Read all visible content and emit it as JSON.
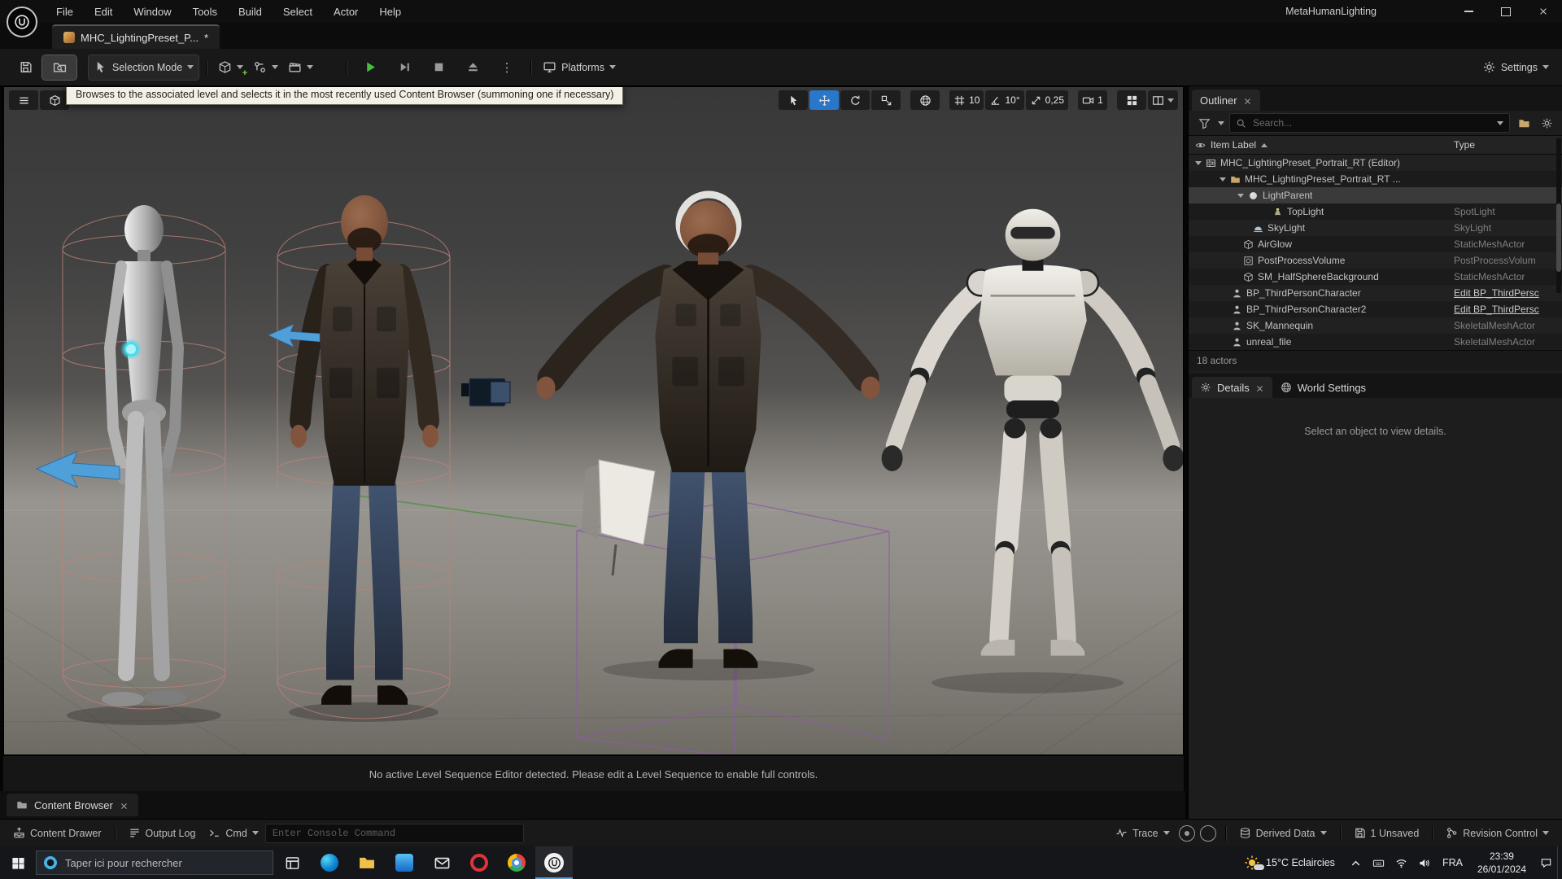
{
  "window": {
    "title": "MetaHumanLighting",
    "menus": [
      "File",
      "Edit",
      "Window",
      "Tools",
      "Build",
      "Select",
      "Actor",
      "Help"
    ]
  },
  "asset_tab": {
    "label": "MHC_LightingPreset_P...",
    "modified_marker": "*"
  },
  "toolbar": {
    "selection_mode_label": "Selection Mode",
    "platforms_label": "Platforms",
    "settings_label": "Settings"
  },
  "tooltip_text": "Browses to the associated level and selects it in the most recently used Content Browser (summoning one if necessary)",
  "viewport": {
    "grid_snap": "10",
    "angle_snap": "10°",
    "scale_snap": "0,25",
    "camera_speed": "1",
    "message": "No active Level Sequence Editor detected. Please edit a Level Sequence to enable full controls."
  },
  "outliner": {
    "title": "Outliner",
    "search_placeholder": "Search...",
    "columns": {
      "item_label": "Item Label",
      "type": "Type"
    },
    "rows": [
      {
        "label": "MHC_LightingPreset_Portrait_RT (Editor)",
        "type": ""
      },
      {
        "label": "MHC_LightingPreset_Portrait_RT ...",
        "type": ""
      },
      {
        "label": "LightParent",
        "type": ""
      },
      {
        "label": "TopLight",
        "type": "SpotLight"
      },
      {
        "label": "SkyLight",
        "type": "SkyLight"
      },
      {
        "label": "AirGlow",
        "type": "StaticMeshActor"
      },
      {
        "label": "PostProcessVolume",
        "type": "PostProcessVolum"
      },
      {
        "label": "SM_HalfSphereBackground",
        "type": "StaticMeshActor"
      },
      {
        "label": "BP_ThirdPersonCharacter",
        "type": "Edit BP_ThirdPersc"
      },
      {
        "label": "BP_ThirdPersonCharacter2",
        "type": "Edit BP_ThirdPersc"
      },
      {
        "label": "SK_Mannequin",
        "type": "SkeletalMeshActor"
      },
      {
        "label": "unreal_file",
        "type": "SkeletalMeshActor"
      }
    ],
    "footer": "18 actors"
  },
  "details": {
    "tab_details": "Details",
    "tab_world_settings": "World Settings",
    "empty_message": "Select an object to view details."
  },
  "content_browser": {
    "tab_label": "Content Browser"
  },
  "status_bar": {
    "content_drawer": "Content Drawer",
    "output_log": "Output Log",
    "cmd": "Cmd",
    "console_placeholder": "Enter Console Command",
    "trace": "Trace",
    "derived_data": "Derived Data",
    "unsaved": "1 Unsaved",
    "revision_control": "Revision Control"
  },
  "taskbar": {
    "search_placeholder": "Taper ici pour rechercher",
    "weather": "15°C Eclaircies",
    "language": "FRA",
    "time": "23:39",
    "date": "26/01/2024"
  },
  "colors": {
    "accent_blue": "#2a77c9",
    "play_green": "#49c03a",
    "tooltip_bg": "#f3f1e6",
    "selected_row": "#3a3a3a"
  }
}
